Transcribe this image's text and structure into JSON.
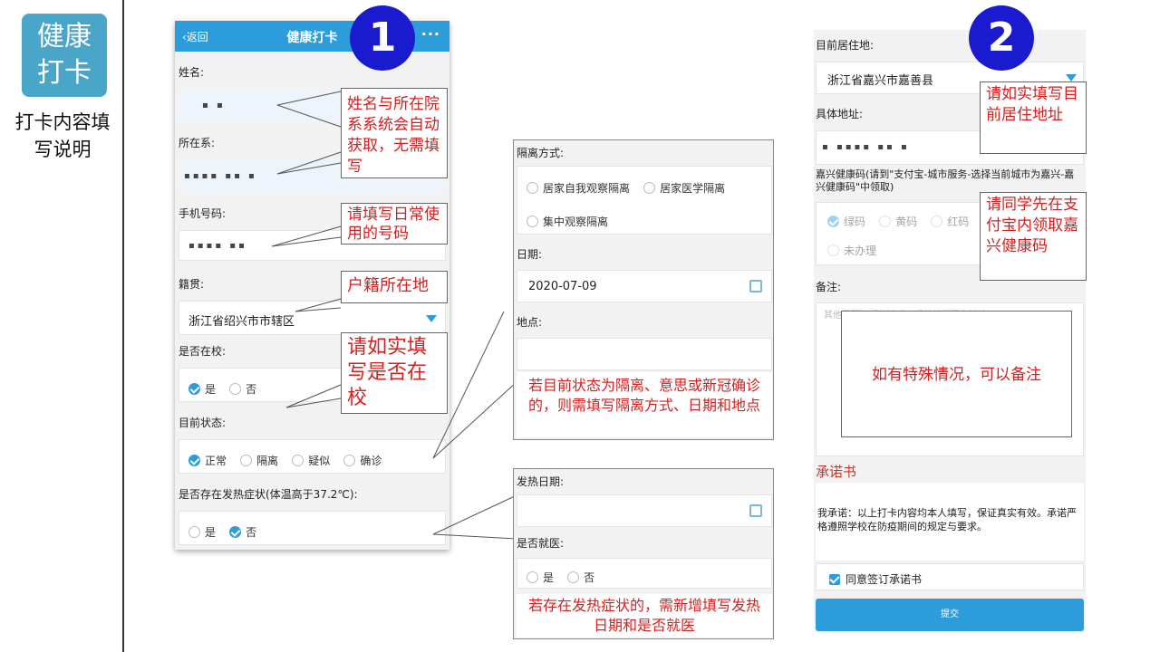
{
  "sidebar": {
    "logo_line1": "健康",
    "logo_line2": "打卡",
    "caption_line1": "打卡内容填",
    "caption_line2": "写说明"
  },
  "badges": [
    "1",
    "2"
  ],
  "phone1": {
    "back_label": "‹返回",
    "title": "健康打卡",
    "more": "···",
    "name_label": "姓名:",
    "name_value": "▪ ▪",
    "dept_label": "所在系:",
    "dept_value": "▪▪▪▪ ▪▪ ▪",
    "phone_label": "手机号码:",
    "phone_value": "▪▪▪▪ ▪▪",
    "origin_label": "籍贯:",
    "origin_value": "浙江省绍兴市市辖区",
    "on_campus_label": "是否在校:",
    "on_campus_options": [
      "是",
      "否"
    ],
    "status_label": "目前状态:",
    "status_options": [
      "正常",
      "隔离",
      "疑似",
      "确诊"
    ],
    "fever_label": "是否存在发热症状(体温高于37.2℃):",
    "fever_options": [
      "是",
      "否"
    ]
  },
  "notes": {
    "auto_fill": "姓名与所在院系系统会自动获取，无需填写",
    "phone_hint": "请填写日常使用的号码",
    "origin_hint": "户籍所在地",
    "campus_hint": "请如实填写是否在校",
    "isolation_hint": "若目前状态为隔离、意思或新冠确诊的，则需填写隔离方式、日期和地点",
    "fever_hint": "若存在发热症状的，需新增填写发热日期和是否就医",
    "residence_hint": "请如实填写目前居住地址",
    "healthcode_hint": "请同学先在支付宝内领取嘉兴健康码",
    "remark_hint": "如有特殊情况，可以备注"
  },
  "isolation_panel": {
    "method_label": "隔离方式:",
    "method_options": [
      "居家自我观察隔离",
      "居家医学隔离",
      "集中观察隔离"
    ],
    "date_label": "日期:",
    "date_value": "2020-07-09",
    "place_label": "地点:"
  },
  "fever_panel": {
    "date_label": "发热日期:",
    "medical_label": "是否就医:",
    "medical_options": [
      "是",
      "否"
    ]
  },
  "phone2": {
    "residence_label": "目前居住地:",
    "residence_value": "浙江省嘉兴市嘉善县",
    "address_label": "具体地址:",
    "address_value": "▪ ▪▪▪▪ ▪▪ ▪",
    "healthcode_label": "嘉兴健康码(请到\"支付宝-城市服务-选择当前城市为嘉兴-嘉兴健康码\"中领取)",
    "healthcode_options": [
      "绿码",
      "黄码",
      "红码",
      "未办理"
    ],
    "remark_label": "备注:",
    "remark_placeholder": "其他需要说明的情况，后续的行程安排等",
    "pledge_title": "承诺书",
    "pledge_text": "我承诺：以上打卡内容均本人填写，保证真实有效。承诺严格遵照学校在防疫期间的规定与要求。",
    "agree_label": "同意签订承诺书",
    "submit_label": "提交"
  }
}
